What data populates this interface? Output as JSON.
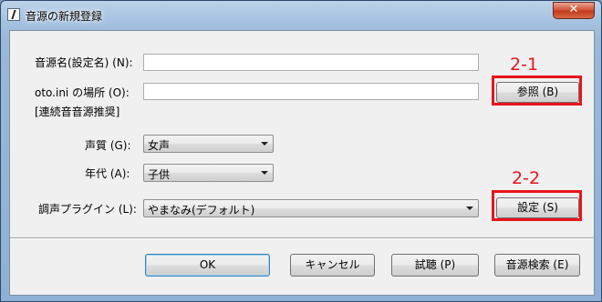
{
  "window": {
    "title": "音源の新規登録",
    "close_label": "✕"
  },
  "form": {
    "name_label": "音源名(設定名) (N):",
    "name_value": "",
    "otoini_label": "oto.ini の場所 (O):",
    "otoini_value": "",
    "otoini_note": "[連続音音源推奨]",
    "browse_button": "参照 (B)",
    "voice_label": "声質 (G):",
    "voice_value": "女声",
    "age_label": "年代 (A):",
    "age_value": "子供",
    "plugin_label": "調声プラグイン (L):",
    "plugin_value": "やまなみ(デフォルト)",
    "settings_button": "設定 (S)"
  },
  "footer": {
    "ok": "OK",
    "cancel": "キャンセル",
    "preview": "試聴 (P)",
    "search": "音源検索 (E)"
  },
  "annotations": {
    "a1_label": "2-1",
    "a2_label": "2-2",
    "color": "#e8141c"
  }
}
